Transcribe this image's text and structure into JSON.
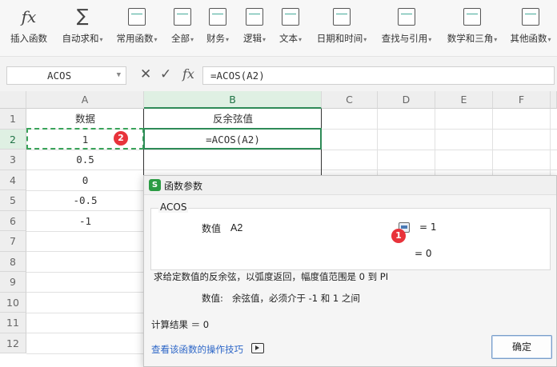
{
  "ribbon": [
    {
      "label": "插入函数",
      "icon": "fx-icon",
      "caret": false
    },
    {
      "label": "自动求和",
      "icon": "sigma-icon",
      "caret": true
    },
    {
      "label": "常用函数",
      "icon": "star-fx-icon",
      "caret": true
    },
    {
      "label": "全部",
      "icon": "fx-box-icon",
      "caret": true
    },
    {
      "label": "财务",
      "icon": "yen-icon",
      "caret": true
    },
    {
      "label": "逻辑",
      "icon": "question-icon",
      "caret": true
    },
    {
      "label": "文本",
      "icon": "text-a-icon",
      "caret": true
    },
    {
      "label": "日期和时间",
      "icon": "clock-icon",
      "caret": true
    },
    {
      "label": "查找与引用",
      "icon": "search-doc-icon",
      "caret": true
    },
    {
      "label": "数学和三角",
      "icon": "math-icon",
      "caret": true
    },
    {
      "label": "其他函数",
      "icon": "more-functions-icon",
      "caret": true
    }
  ],
  "formula_bar": {
    "name_box": "ACOS",
    "fx_glyph": "fx",
    "formula": "=ACOS(A2)"
  },
  "grid": {
    "columns": [
      "A",
      "B",
      "C",
      "D",
      "E",
      "F"
    ],
    "rows": [
      "1",
      "2",
      "3",
      "4",
      "5",
      "6",
      "7",
      "8",
      "9",
      "10",
      "11",
      "12"
    ],
    "header_a": "数据",
    "header_b": "反余弦值",
    "col_a_values": [
      "1",
      "0.5",
      "0",
      "-0.5",
      "-1"
    ],
    "b2_formula": "=ACOS(A2)"
  },
  "badges": {
    "one": "1",
    "two": "2"
  },
  "dialog": {
    "title": "函数参数",
    "function_name": "ACOS",
    "arg_label": "数值",
    "arg_value": "A2",
    "arg_eval": "= 1",
    "result_eval": "= 0",
    "description": "求给定数值的反余弦，以弧度返回，幅度值范围是 0 到 PI",
    "arg_desc_label": "数值:",
    "arg_desc": "余弦值，必须介于 -1 和 1 之间",
    "calc_result": "计算结果 ＝ 0",
    "help_link": "查看该函数的操作技巧",
    "ok_label": "确定"
  },
  "colors": {
    "accent_green": "#2e8b57",
    "badge_red": "#e8333b",
    "link_blue": "#2d66c7"
  }
}
